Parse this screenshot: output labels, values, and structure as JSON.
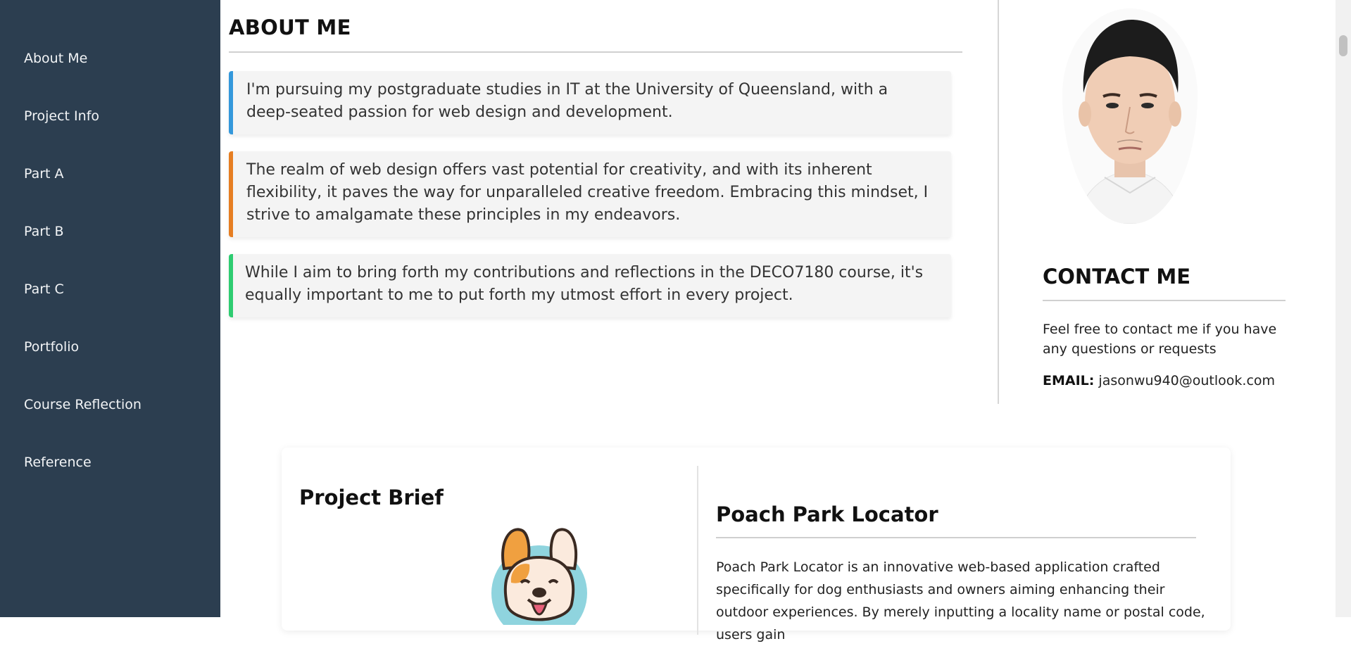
{
  "sidebar": {
    "items": [
      {
        "label": "About Me"
      },
      {
        "label": "Project Info"
      },
      {
        "label": "Part A"
      },
      {
        "label": "Part B"
      },
      {
        "label": "Part C"
      },
      {
        "label": "Portfolio"
      },
      {
        "label": "Course Reflection"
      },
      {
        "label": "Reference"
      }
    ]
  },
  "about": {
    "title": "ABOUT ME",
    "paragraphs": [
      "I'm pursuing my postgraduate studies in IT at the University of Queensland, with a deep-seated passion for web design and development.",
      "The realm of web design offers vast potential for creativity, and with its inherent flexibility, it paves the way for unparalleled creative freedom. Embracing this mindset, I strive to amalgamate these principles in my endeavors.",
      "While I aim to bring forth my contributions and reflections in the DECO7180 course, it's equally important to me to put forth my utmost effort in every project."
    ],
    "accent_colors": [
      "#3498db",
      "#e67e22",
      "#2ecc71"
    ]
  },
  "contact": {
    "title": "CONTACT ME",
    "text": "Feel free to contact me if you have any questions or requests",
    "email_label": "EMAIL:",
    "email": "jasonwu940@outlook.com"
  },
  "project": {
    "brief_title": "Project Brief",
    "name": "Poach Park Locator",
    "description": "Poach Park Locator is an innovative web-based application crafted specifically for dog enthusiasts and owners aiming enhancing their outdoor experiences. By merely inputting a locality name or postal code, users gain"
  },
  "colors": {
    "sidebar_bg": "#2c3e50",
    "sidebar_text": "#f2f4f6"
  }
}
